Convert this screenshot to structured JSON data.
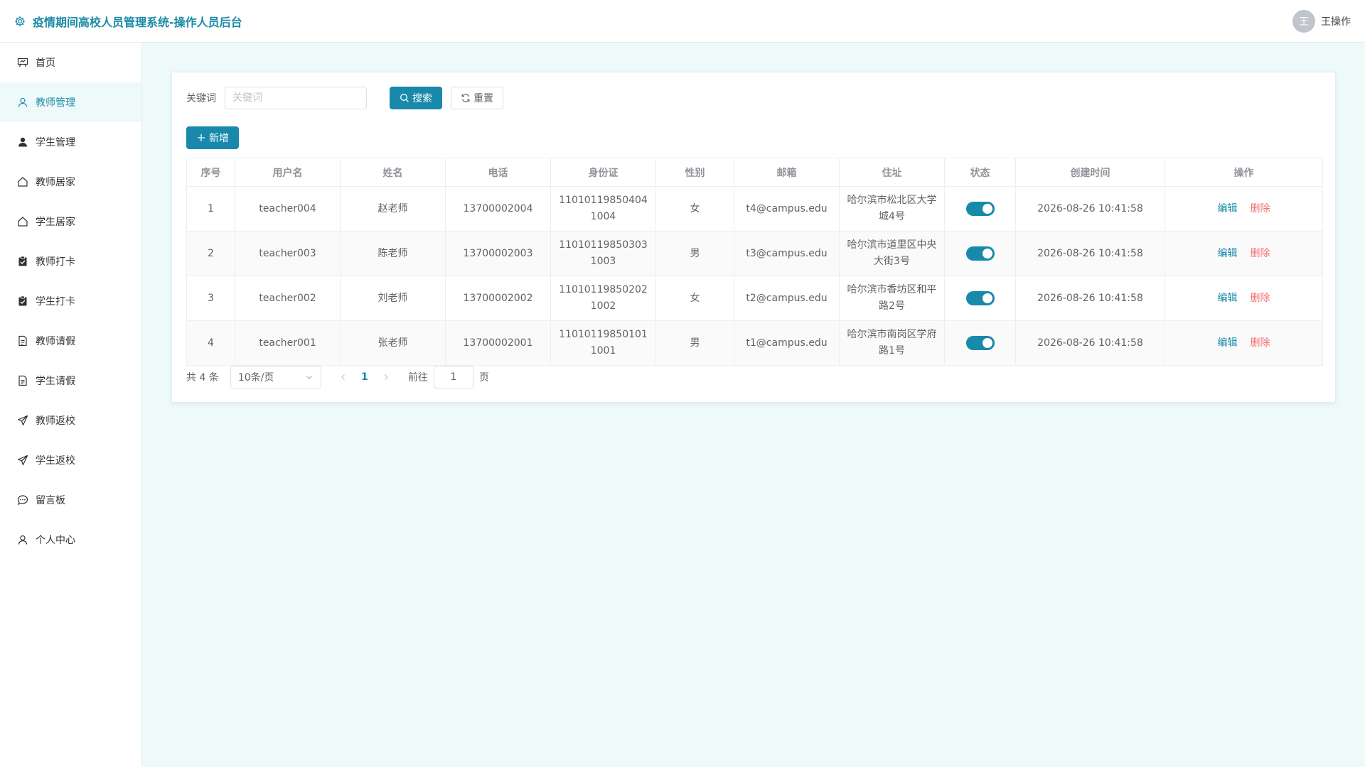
{
  "header": {
    "title": "疫情期间高校人员管理系统-操作人员后台",
    "avatar_text": "王",
    "username": "王操作"
  },
  "sidebar": {
    "items": [
      {
        "label": "首页",
        "icon": "presentation-icon"
      },
      {
        "label": "教师管理",
        "icon": "user-outline-icon",
        "active": true
      },
      {
        "label": "学生管理",
        "icon": "user-filled-icon"
      },
      {
        "label": "教师居家",
        "icon": "house-icon"
      },
      {
        "label": "学生居家",
        "icon": "house-icon"
      },
      {
        "label": "教师打卡",
        "icon": "clipboard-check-icon"
      },
      {
        "label": "学生打卡",
        "icon": "clipboard-check-icon"
      },
      {
        "label": "教师请假",
        "icon": "document-icon"
      },
      {
        "label": "学生请假",
        "icon": "document-icon"
      },
      {
        "label": "教师返校",
        "icon": "send-icon"
      },
      {
        "label": "学生返校",
        "icon": "send-icon"
      },
      {
        "label": "留言板",
        "icon": "chat-icon"
      },
      {
        "label": "个人中心",
        "icon": "user-outline-icon"
      }
    ]
  },
  "search": {
    "label": "关键词",
    "placeholder": "关键词",
    "search_label": "搜索",
    "reset_label": "重置"
  },
  "toolbar": {
    "add_label": "新增"
  },
  "table": {
    "columns": [
      "序号",
      "用户名",
      "姓名",
      "电话",
      "身份证",
      "性别",
      "邮箱",
      "住址",
      "状态",
      "创建时间",
      "操作"
    ],
    "rows": [
      {
        "index": "1",
        "username": "teacher004",
        "name": "赵老师",
        "phone": "13700002004",
        "id_card": "110101198504041004",
        "gender": "女",
        "email": "t4@campus.edu",
        "address": "哈尔滨市松北区大学城4号",
        "status": true,
        "created": "2026-08-26 10:41:58"
      },
      {
        "index": "2",
        "username": "teacher003",
        "name": "陈老师",
        "phone": "13700002003",
        "id_card": "110101198503031003",
        "gender": "男",
        "email": "t3@campus.edu",
        "address": "哈尔滨市道里区中央大街3号",
        "status": true,
        "created": "2026-08-26 10:41:58"
      },
      {
        "index": "3",
        "username": "teacher002",
        "name": "刘老师",
        "phone": "13700002002",
        "id_card": "110101198502021002",
        "gender": "女",
        "email": "t2@campus.edu",
        "address": "哈尔滨市香坊区和平路2号",
        "status": true,
        "created": "2026-08-26 10:41:58"
      },
      {
        "index": "4",
        "username": "teacher001",
        "name": "张老师",
        "phone": "13700002001",
        "id_card": "110101198501011001",
        "gender": "男",
        "email": "t1@campus.edu",
        "address": "哈尔滨市南岗区学府路1号",
        "status": true,
        "created": "2026-08-26 10:41:58"
      }
    ],
    "edit_label": "编辑",
    "delete_label": "删除"
  },
  "pagination": {
    "total_text": "共 4 条",
    "page_size": "10条/页",
    "current_page": "1",
    "goto_label": "前往",
    "goto_value": "1",
    "page_suffix": "页"
  },
  "colors": {
    "primary": "#1889aa",
    "danger": "#f56c6c",
    "background": "#eefaf9"
  }
}
